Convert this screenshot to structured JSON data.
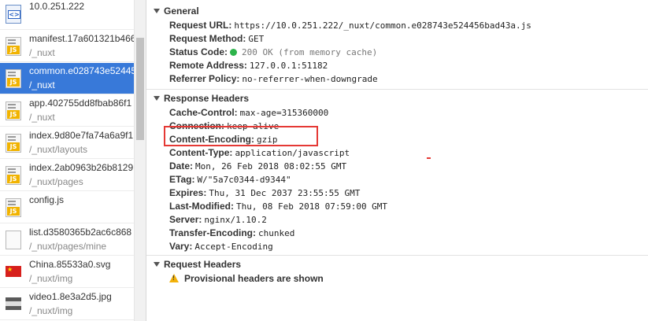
{
  "requests": [
    {
      "icon": "html-document-icon",
      "name": "10.0.251.222",
      "path": "",
      "selected": false
    },
    {
      "icon": "js-file-icon",
      "name": "manifest.17a601321b466",
      "path": "/_nuxt",
      "selected": false
    },
    {
      "icon": "js-file-icon",
      "name": "common.e028743e52445",
      "path": "/_nuxt",
      "selected": true
    },
    {
      "icon": "js-file-icon",
      "name": "app.402755dd8fbab86f1",
      "path": "/_nuxt",
      "selected": false
    },
    {
      "icon": "js-file-icon",
      "name": "index.9d80e7fa74a6a9f1",
      "path": "/_nuxt/layouts",
      "selected": false
    },
    {
      "icon": "js-file-icon",
      "name": "index.2ab0963b26b8129",
      "path": "/_nuxt/pages",
      "selected": false
    },
    {
      "icon": "js-file-icon",
      "name": "config.js",
      "path": "",
      "selected": false
    },
    {
      "icon": "file-icon",
      "name": "list.d3580365b2ac6c868",
      "path": "/_nuxt/pages/mine",
      "selected": false
    },
    {
      "icon": "china-flag-icon",
      "name": "China.85533a0.svg",
      "path": "/_nuxt/img",
      "selected": false
    },
    {
      "icon": "image-thumbnail-icon",
      "name": "video1.8e3a2d5.jpg",
      "path": "/_nuxt/img",
      "selected": false
    }
  ],
  "general": {
    "title": "General",
    "request_url_label": "Request URL:",
    "request_url": "https://10.0.251.222/_nuxt/common.e028743e524456bad43a.js",
    "request_method_label": "Request Method:",
    "request_method": "GET",
    "status_code_label": "Status Code:",
    "status_code": "200 OK (from memory cache)",
    "remote_address_label": "Remote Address:",
    "remote_address": "127.0.0.1:51182",
    "referrer_policy_label": "Referrer Policy:",
    "referrer_policy": "no-referrer-when-downgrade"
  },
  "response_headers": {
    "title": "Response Headers",
    "items": [
      {
        "key": "Cache-Control:",
        "value": "max-age=315360000"
      },
      {
        "key": "Connection:",
        "value": "keep-alive"
      },
      {
        "key": "Content-Encoding:",
        "value": "gzip"
      },
      {
        "key": "Content-Type:",
        "value": "application/javascript"
      },
      {
        "key": "Date:",
        "value": "Mon, 26 Feb 2018 08:02:55 GMT"
      },
      {
        "key": "ETag:",
        "value": "W/\"5a7c0344-d9344\""
      },
      {
        "key": "Expires:",
        "value": "Thu, 31 Dec 2037 23:55:55 GMT"
      },
      {
        "key": "Last-Modified:",
        "value": "Thu, 08 Feb 2018 07:59:00 GMT"
      },
      {
        "key": "Server:",
        "value": "nginx/1.10.2"
      },
      {
        "key": "Transfer-Encoding:",
        "value": "chunked"
      },
      {
        "key": "Vary:",
        "value": "Accept-Encoding"
      }
    ]
  },
  "request_headers": {
    "title": "Request Headers",
    "warning": "Provisional headers are shown"
  },
  "colors": {
    "selected_row": "#3879d9",
    "status_ok": "#2cb34a",
    "highlight_box": "#e53935",
    "warning": "#f3b20a"
  }
}
